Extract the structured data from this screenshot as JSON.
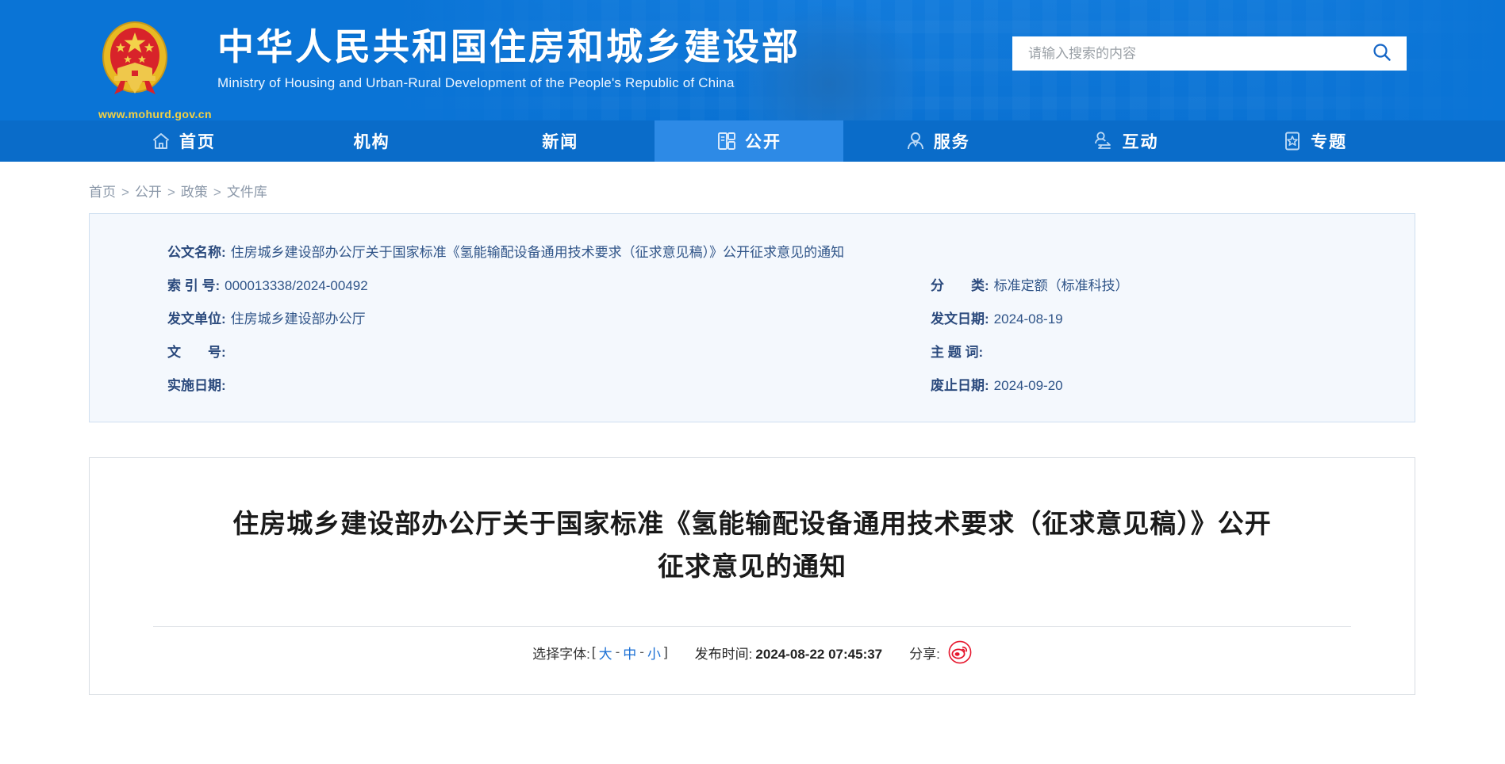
{
  "header": {
    "brand_cn": "中华人民共和国住房和城乡建设部",
    "brand_en": "Ministry of Housing and Urban-Rural Development of the People's Republic of China",
    "url": "www.mohurd.gov.cn",
    "emblem_icon": "national-emblem-icon",
    "search": {
      "placeholder": "请输入搜索的内容",
      "value": "",
      "icon": "search-icon"
    }
  },
  "nav": {
    "items": [
      {
        "label": "首页",
        "icon": "home-icon",
        "active": false
      },
      {
        "label": "机构",
        "icon": "",
        "active": false
      },
      {
        "label": "新闻",
        "icon": "",
        "active": false
      },
      {
        "label": "公开",
        "icon": "document-icon",
        "active": true
      },
      {
        "label": "服务",
        "icon": "service-icon",
        "active": false
      },
      {
        "label": "互动",
        "icon": "interact-icon",
        "active": false
      },
      {
        "label": "专题",
        "icon": "star-icon",
        "active": false
      }
    ],
    "active_color": "#2d8ae6",
    "bar_color": "#0a6cc9"
  },
  "breadcrumb": {
    "items": [
      "首页",
      "公开",
      "政策",
      "文件库"
    ],
    "separator": ">"
  },
  "meta": {
    "doc_name_key": "公文名称:",
    "doc_name_val": "住房城乡建设部办公厅关于国家标准《氢能输配设备通用技术要求（征求意见稿）》公开征求意见的通知",
    "rows": [
      {
        "left_key": "索 引 号:",
        "left_val": "000013338/2024-00492",
        "right_key": "分　　类:",
        "right_val": "标准定额（标准科技）"
      },
      {
        "left_key": "发文单位:",
        "left_val": "住房城乡建设部办公厅",
        "right_key": "发文日期:",
        "right_val": "2024-08-19"
      },
      {
        "left_key": "文　　号:",
        "left_val": "",
        "right_key": "主 题 词:",
        "right_val": ""
      },
      {
        "left_key": "实施日期:",
        "left_val": "",
        "right_key": "废止日期:",
        "right_val": "2024-09-20"
      }
    ]
  },
  "article": {
    "title": "住房城乡建设部办公厅关于国家标准《氢能输配设备通用技术要求（征求意见稿）》公开征求意见的通知",
    "font_picker": {
      "label": "选择字体:",
      "open_bracket": "[",
      "close_bracket": "]",
      "sizes": [
        "大",
        "中",
        "小"
      ],
      "dash": "-"
    },
    "publish": {
      "label": "发布时间:",
      "value": "2024-08-22 07:45:37"
    },
    "share": {
      "label": "分享:",
      "icon": "weibo-icon",
      "icon_color": "#e6162d"
    }
  },
  "colors": {
    "brand_blue": "#0a74d6",
    "nav_blue": "#0a6cc9",
    "nav_active": "#2d8ae6",
    "meta_bg": "#f4f8fd",
    "meta_border": "#cfdff0",
    "meta_key": "#2b4a7d",
    "meta_val": "#2f5488",
    "link_blue": "#1a6fd4",
    "url_gold": "#f5d142"
  }
}
